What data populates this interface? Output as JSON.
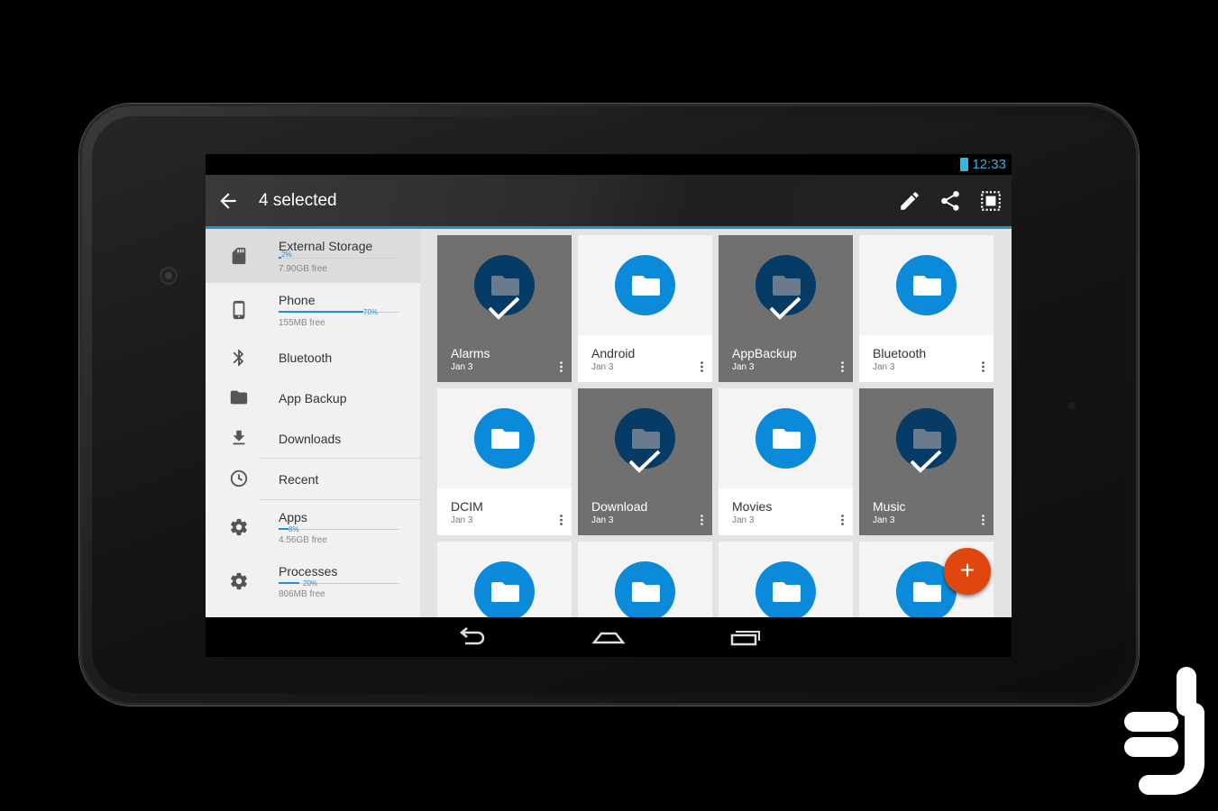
{
  "status_bar": {
    "time": "12:33",
    "battery_icon": "battery-charging-icon"
  },
  "app_bar": {
    "back_icon": "arrow-left-icon",
    "title": "4 selected",
    "actions": [
      "edit-icon",
      "share-icon",
      "select-all-icon"
    ]
  },
  "drawer": {
    "items": [
      {
        "label": "External Storage",
        "icon": "sd-card-icon",
        "usage_pct": "2%",
        "usage_value": 0.02,
        "free": "7.90GB free",
        "selected": true
      },
      {
        "label": "Phone",
        "icon": "phone-icon",
        "usage_pct": "70%",
        "usage_value": 0.7,
        "free": "155MB free"
      },
      {
        "label": "Bluetooth",
        "icon": "bluetooth-icon"
      },
      {
        "label": "App Backup",
        "icon": "folder-icon"
      },
      {
        "label": "Downloads",
        "icon": "download-icon"
      },
      {
        "label": "Recent",
        "icon": "clock-icon"
      },
      {
        "label": "Apps",
        "icon": "gear-icon",
        "usage_pct": "8%",
        "usage_value": 0.08,
        "free": "4.56GB free"
      },
      {
        "label": "Processes",
        "icon": "gear-icon",
        "usage_pct": "20%",
        "usage_value": 0.2,
        "free": "806MB free"
      }
    ]
  },
  "grid": {
    "folders": [
      {
        "name": "Alarms",
        "date": "Jan 3",
        "selected": true
      },
      {
        "name": "Android",
        "date": "Jan 3",
        "selected": false
      },
      {
        "name": "AppBackup",
        "date": "Jan 3",
        "selected": true
      },
      {
        "name": "Bluetooth",
        "date": "Jan 3",
        "selected": false
      },
      {
        "name": "DCIM",
        "date": "Jan 3",
        "selected": false
      },
      {
        "name": "Download",
        "date": "Jan 3",
        "selected": true
      },
      {
        "name": "Movies",
        "date": "Jan 3",
        "selected": false
      },
      {
        "name": "Music",
        "date": "Jan 3",
        "selected": true
      },
      {
        "name": "",
        "date": "",
        "selected": false
      },
      {
        "name": "",
        "date": "",
        "selected": false
      },
      {
        "name": "",
        "date": "",
        "selected": false
      },
      {
        "name": "",
        "date": "",
        "selected": false
      }
    ]
  },
  "fab": {
    "label": "+"
  },
  "nav_bar": {
    "buttons": [
      "back-nav-icon",
      "home-nav-icon",
      "recents-nav-icon"
    ]
  },
  "colors": {
    "accent": "#1e90d8",
    "folder_blue": "#0a8ad8",
    "fab_orange": "#e0470e"
  }
}
